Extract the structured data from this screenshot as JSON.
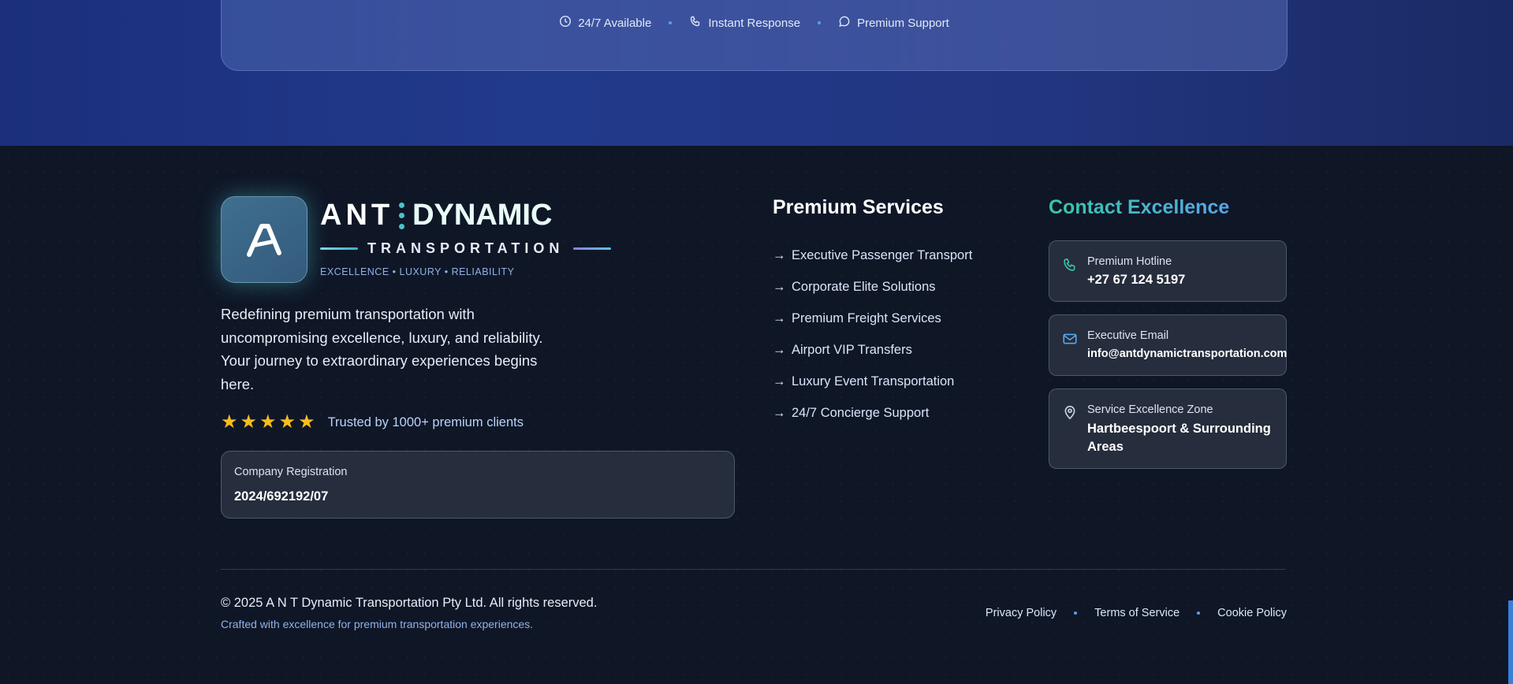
{
  "cta": {
    "features": [
      {
        "icon": "clock-icon",
        "label": "24/7 Available"
      },
      {
        "icon": "phone-icon",
        "label": "Instant Response"
      },
      {
        "icon": "chat-icon",
        "label": "Premium Support"
      }
    ]
  },
  "brand": {
    "logo_letter": "A",
    "name_part1": "ANT",
    "name_part2": "DYNAMIC",
    "subtitle": "TRANSPORTATION",
    "tagline": "EXCELLENCE • LUXURY • RELIABILITY"
  },
  "about": {
    "text": "Redefining premium transportation with uncompromising excellence, luxury, and reliability. Your journey to extraordinary experiences begins here.",
    "rating_stars": 5,
    "trusted": "Trusted by 1000+ premium clients"
  },
  "registration": {
    "label": "Company Registration",
    "value": "2024/692192/07"
  },
  "services": {
    "title": "Premium Services",
    "items": [
      "Executive Passenger Transport",
      "Corporate Elite Solutions",
      "Premium Freight Services",
      "Airport VIP Transfers",
      "Luxury Event Transportation",
      "24/7 Concierge Support"
    ]
  },
  "contact": {
    "title": "Contact Excellence",
    "hotline": {
      "icon": "phone-icon",
      "label": "Premium Hotline",
      "value": "+27 67 124 5197"
    },
    "email": {
      "icon": "mail-icon",
      "label": "Executive Email",
      "value": "info@antdynamictransportation.com"
    },
    "zone": {
      "icon": "map-pin-icon",
      "label": "Service Excellence Zone",
      "value": "Hartbeespoort & Surrounding Areas"
    }
  },
  "bottom": {
    "copyright": "© 2025 A N T Dynamic Transportation Pty Ltd. All rights reserved.",
    "crafted": "Crafted with excellence for premium transportation experiences.",
    "links": [
      "Privacy Policy",
      "Terms of Service",
      "Cookie Policy"
    ]
  },
  "colors": {
    "accent_teal": "#37c7a8",
    "accent_blue": "#57a6e9",
    "star": "#f8bd1c",
    "footer_bg": "#0f1626",
    "band_bg": "#22357f"
  }
}
